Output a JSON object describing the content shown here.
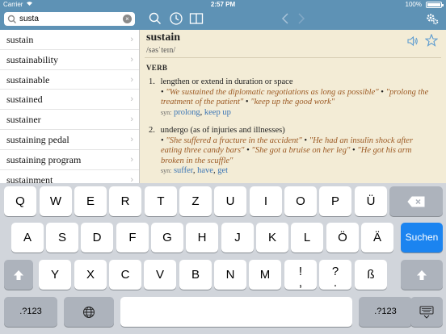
{
  "status_bar": {
    "carrier": "Carrier",
    "time": "2:57 PM",
    "battery": "100%"
  },
  "search": {
    "value": "susta",
    "placeholder": ""
  },
  "toolbar": {
    "icons": [
      "search-icon",
      "history-icon",
      "book-icon",
      "back-arrow-icon",
      "forward-arrow-icon",
      "settings-icon"
    ]
  },
  "results": [
    "sustain",
    "sustainability",
    "sustainable",
    "sustained",
    "sustainer",
    "sustaining pedal",
    "sustaining program",
    "sustainment"
  ],
  "entry": {
    "headword": "sustain",
    "pronunciation": "/səsˈteɪn/",
    "part_of_speech": "VERB",
    "senses": [
      {
        "num": "1.",
        "definition": "lengthen or extend in duration or space",
        "examples": [
          "\"We sustained the diplomatic negotiations as long as possible\"",
          "\"prolong the treatment of the patient\"",
          "\"keep up the good work\""
        ],
        "syn_label": "syn:",
        "synonyms": [
          "prolong",
          "keep up"
        ]
      },
      {
        "num": "2.",
        "definition": "undergo (as of injuries and illnesses)",
        "examples": [
          "\"She suffered a fracture in the accident\"",
          "\"He had an insulin shock after eating three candy bars\"",
          "\"She got a bruise on her leg\"",
          "\"He got his arm broken in the scuffle\""
        ],
        "syn_label": "syn:",
        "synonyms": [
          "suffer",
          "have",
          "get"
        ]
      }
    ]
  },
  "keyboard": {
    "row1": [
      "Q",
      "W",
      "E",
      "R",
      "T",
      "Z",
      "U",
      "I",
      "O",
      "P",
      "Ü"
    ],
    "row2": [
      "A",
      "S",
      "D",
      "F",
      "G",
      "H",
      "J",
      "K",
      "L",
      "Ö",
      "Ä"
    ],
    "row3": [
      "Y",
      "X",
      "C",
      "V",
      "B",
      "N",
      "M",
      "!",
      "?",
      "ß"
    ],
    "row3_punct_top": [
      ",",
      "."
    ],
    "row3_punct_bottom": [
      "'",
      "?"
    ],
    "search_key": "Suchen",
    "numbers_key": ".?123"
  },
  "colors": {
    "header": "#5e92b5",
    "definition_bg": "#f3ecd6",
    "example": "#9c5a24",
    "synonym": "#3c76b5",
    "search_key": "#1b84f0"
  }
}
